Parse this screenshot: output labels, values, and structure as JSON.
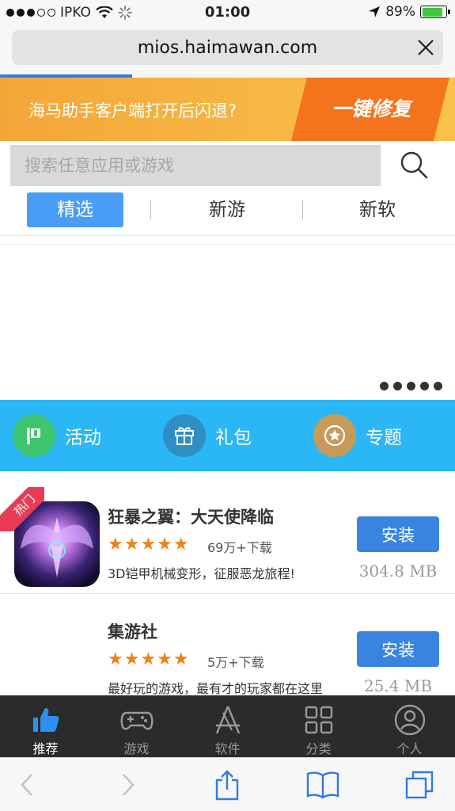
{
  "status_bar": {
    "carrier": "IPKO",
    "time": "01:00",
    "battery": "89%",
    "battery_level": 0.89
  },
  "browser": {
    "url": "mios.haimawan.com",
    "load_progress": 0.29
  },
  "banner": {
    "text": "海马助手客户端打开后闪退?",
    "button_label": "一键修复"
  },
  "search": {
    "placeholder": "搜索任意应用或游戏"
  },
  "tabs": [
    {
      "label": "精选",
      "active": true
    },
    {
      "label": "新游",
      "active": false
    },
    {
      "label": "新软",
      "active": false
    }
  ],
  "carousel": {
    "dot_count": 5
  },
  "quick_nav": [
    {
      "label": "活动",
      "icon": "flag-icon",
      "color": "#3fc46f"
    },
    {
      "label": "礼包",
      "icon": "gift-icon",
      "color": "#2f8fc4"
    },
    {
      "label": "专题",
      "icon": "star-badge-icon",
      "color": "#c89a5a"
    }
  ],
  "apps": [
    {
      "name": "狂暴之翼：大天使降临",
      "rating": 5,
      "stars": "★★★★★",
      "downloads": "69万+下载",
      "description": "3D铠甲机械变形，征服恶龙旅程!",
      "install_label": "安装",
      "size": "304.8 MB",
      "badge": "热门"
    },
    {
      "name": "集游社",
      "rating": 5,
      "stars": "★★★★★",
      "downloads": "5万+下载",
      "description": "最好玩的游戏，最有才的玩家都在这里",
      "install_label": "安装",
      "size": "25.4 MB"
    }
  ],
  "bottom_nav": [
    {
      "label": "推荐",
      "icon": "thumbs-up-icon",
      "active": true
    },
    {
      "label": "游戏",
      "icon": "gamepad-icon",
      "active": false
    },
    {
      "label": "软件",
      "icon": "app-store-icon",
      "active": false
    },
    {
      "label": "分类",
      "icon": "grid-icon",
      "active": false
    },
    {
      "label": "个人",
      "icon": "user-icon",
      "active": false
    }
  ],
  "colors": {
    "accent": "#4a9df5",
    "banner_orange": "#f4741e",
    "quick_nav_bg": "#2bb6f6",
    "star": "#f0811a",
    "install_button": "#3a84e0"
  }
}
